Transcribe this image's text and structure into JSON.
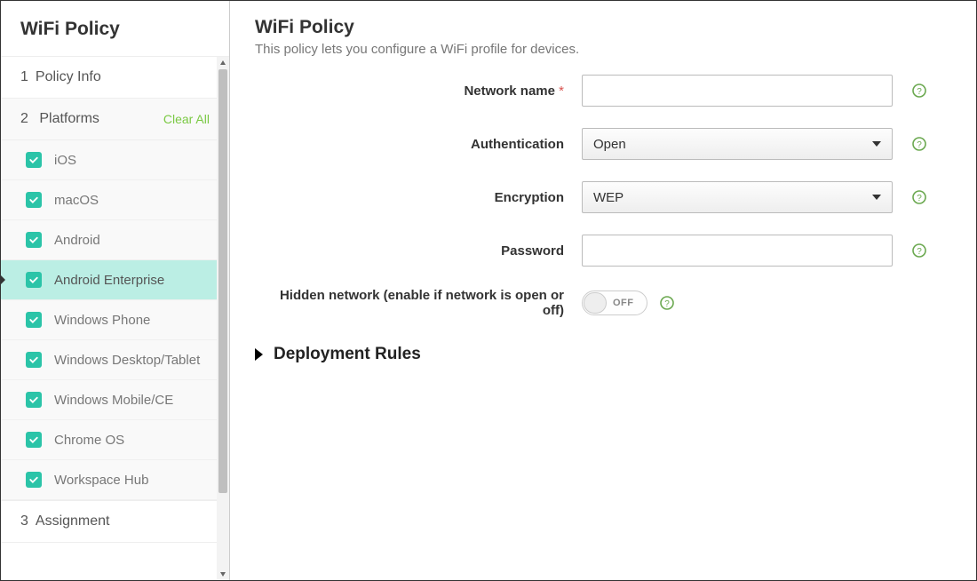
{
  "sidebar": {
    "title": "WiFi Policy",
    "steps": {
      "policy_info": {
        "num": "1",
        "label": "Policy Info"
      },
      "platforms": {
        "num": "2",
        "label": "Platforms",
        "clear_all": "Clear All"
      },
      "assignment": {
        "num": "3",
        "label": "Assignment"
      }
    },
    "platforms": [
      {
        "label": "iOS"
      },
      {
        "label": "macOS"
      },
      {
        "label": "Android"
      },
      {
        "label": "Android Enterprise"
      },
      {
        "label": "Windows Phone"
      },
      {
        "label": "Windows Desktop/Tablet"
      },
      {
        "label": "Windows Mobile/CE"
      },
      {
        "label": "Chrome OS"
      },
      {
        "label": "Workspace Hub"
      }
    ]
  },
  "main": {
    "title": "WiFi Policy",
    "subtitle": "This policy lets you configure a WiFi profile for devices.",
    "fields": {
      "network_name": {
        "label": "Network name",
        "required": "*",
        "value": ""
      },
      "authentication": {
        "label": "Authentication",
        "value": "Open"
      },
      "encryption": {
        "label": "Encryption",
        "value": "WEP"
      },
      "password": {
        "label": "Password",
        "value": ""
      },
      "hidden": {
        "label": "Hidden network (enable if network is open or off)",
        "value": "OFF"
      }
    },
    "deployment_rules": "Deployment Rules"
  }
}
